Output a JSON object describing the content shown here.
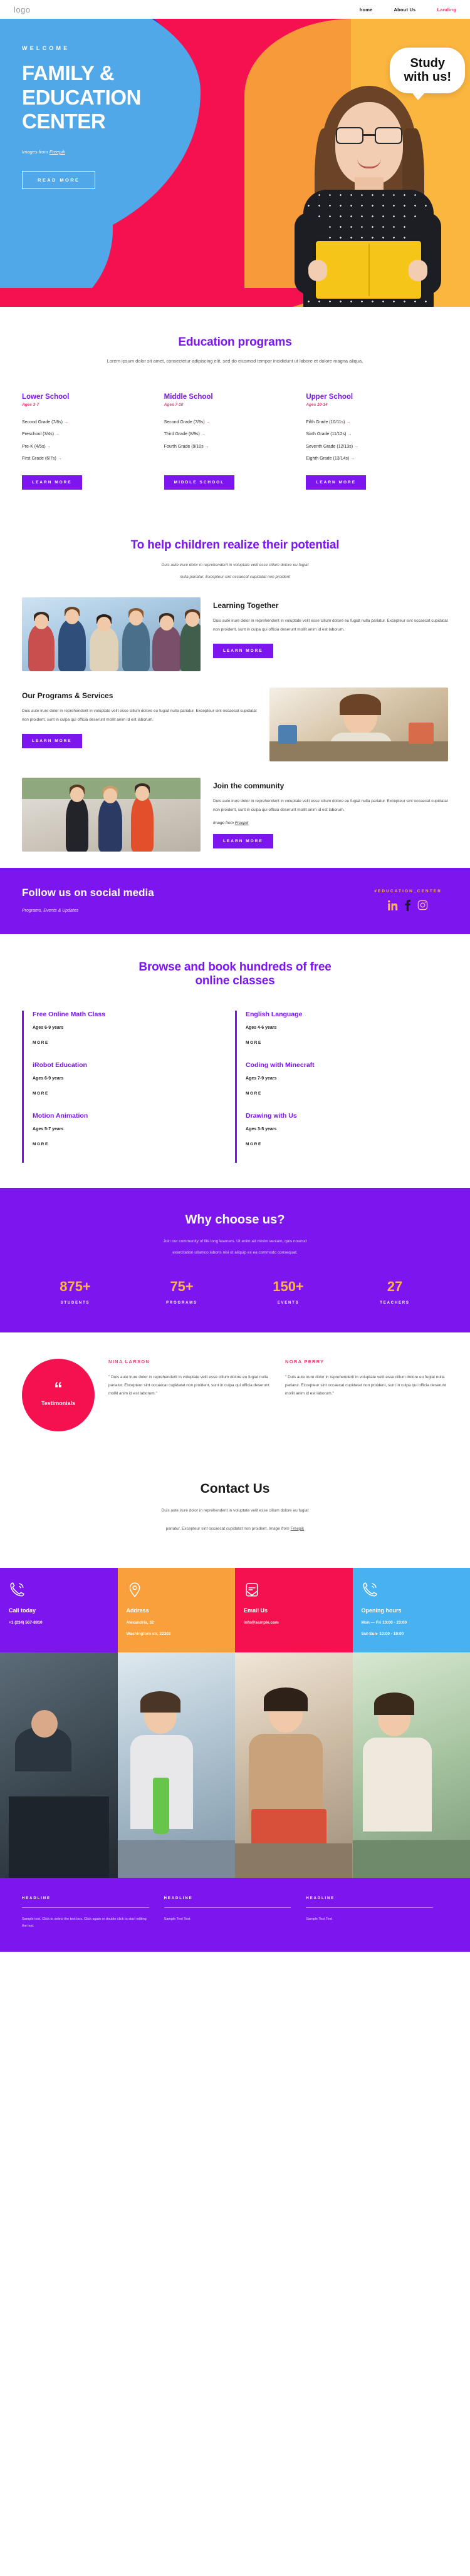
{
  "header": {
    "logo": "logo",
    "nav": [
      {
        "label": "home",
        "active": false
      },
      {
        "label": "About Us",
        "active": false
      },
      {
        "label": "Landing",
        "active": true
      }
    ]
  },
  "hero": {
    "welcome": "WELCOME",
    "title": "FAMILY & EDUCATION CENTER",
    "credit_prefix": "Images from ",
    "credit_link": "Freepik",
    "button": "READ MORE",
    "bubble_line1": "Study",
    "bubble_line2": "with us!"
  },
  "programs": {
    "title": "Education programs",
    "subtitle": "Lorem ipsum dolor sit amet, consectetur adipiscing elit, sed do eiusmod tempor incididunt ut labore et dolore magna aliqua.",
    "columns": [
      {
        "name": "Lower School",
        "age": "Ages 3-7",
        "items": [
          "Second Grade (7/8s)",
          "Preschool (3/4s)",
          "Pre-K (4/5s)",
          "First Grade (6/7s)"
        ],
        "button": "LEARN MORE"
      },
      {
        "name": "Middle School",
        "age": "Ages 7-10",
        "items": [
          "Second Grade (7/8s)",
          "Third Grade (8/9s)",
          "Fourth Grade (9/10s"
        ],
        "button": "MIDDLE SCHOOL"
      },
      {
        "name": "Upper School",
        "age": "Ages 10-14",
        "items": [
          "Fifth Grade (10/11s)",
          "Sixth Grade (11/12s)",
          "Seventh Grade (12/13s)",
          "Eighth Grade (13/14s)"
        ],
        "button": "LEARN MORE"
      }
    ]
  },
  "potential": {
    "title": "To help children realize their potential",
    "sub_line1": "Duis aute irure dolor in reprehenderit in voluptate velit esse cillum dolore eu fugiat",
    "sub_line2": "nulla pariatur. Excepteur sint occaecat cupidatat non proident"
  },
  "features": [
    {
      "title": "Learning Together",
      "body": "Duis aute irure dolor in reprehenderit in voluptate velit esse cillum dolore eu fugiat nulla pariatur. Excepteur sint occaecat cupidatat non proident, sunt in culpa qui officia deserunt mollit anim id est laborum.",
      "button": "LEARN MORE",
      "credit_prefix": "",
      "credit_link": ""
    },
    {
      "title": "Our Programs & Services",
      "body": "Duis aute irure dolor in reprehenderit in voluptate velit esse cillum dolore eu fugiat nulla pariatur. Excepteur sint occaecat cupidatat non proident, sunt in culpa qui officia deserunt mollit anim id est laborum.",
      "button": "LEARN MORE",
      "credit_prefix": "",
      "credit_link": ""
    },
    {
      "title": "Join the community",
      "body": "Duis aute irure dolor in reprehenderit in voluptate velit esse cillum dolore eu fugiat nulla pariatur. Excepteur sint occaecat cupidatat non proident, sunt in culpa qui officia deserunt mollit anim id est laborum.",
      "button": "LEARN MORE",
      "credit_prefix": "Image from ",
      "credit_link": "Freepik"
    }
  ],
  "social": {
    "title": "Follow us on social media",
    "subtitle": "Programs, Events & Updates",
    "hashtag": "#EDUCATION_CENTER",
    "icons": [
      "linkedin-icon",
      "facebook-icon",
      "instagram-icon"
    ]
  },
  "classes": {
    "title_line1": "Browse and book hundreds of free",
    "title_line2": "online classes",
    "items": [
      {
        "name": "Free Online Math Class",
        "age": "Ages 6-9 years",
        "more": "MORE"
      },
      {
        "name": "English Language",
        "age": "Ages 4-6 years",
        "more": "MORE"
      },
      {
        "name": "iRobot Education",
        "age": "Ages 6-9 years",
        "more": "MORE"
      },
      {
        "name": "Coding with Minecraft",
        "age": "Ages 7-9 years",
        "more": "MORE"
      },
      {
        "name": "Motion Animation",
        "age": "Ages 5-7 years",
        "more": "MORE"
      },
      {
        "name": "Drawing with Us",
        "age": "Ages 3-5 years",
        "more": "MORE"
      }
    ]
  },
  "why": {
    "title": "Why choose us?",
    "sub_line1": "Join our community of life long learners. Ut enim ad minim veniam, quis nostrud",
    "sub_line2": "exercitation ullamco laboris nisi ut aliquip ex ea commodo consequat.",
    "stats": [
      {
        "number": "875+",
        "label": "STUDENTS"
      },
      {
        "number": "75+",
        "label": "PROGRAMS"
      },
      {
        "number": "150+",
        "label": "EVENTS"
      },
      {
        "number": "27",
        "label": "TEACHERS"
      }
    ]
  },
  "testimonials": {
    "badge_label": "Testimonials",
    "items": [
      {
        "name": "NINA LARSON",
        "body": "\" Duis aute irure dolor in reprehenderit in voluptate velit esse cillum dolore eu fugiat nulla pariatur. Excepteur sint occaecat cupidatat non proident, sunt in culpa qui officia deserunt mollit anim id est laborum.\""
      },
      {
        "name": "NORA PERRY",
        "body": "\" Duis aute irure dolor in reprehenderit in voluptate velit esse cillum dolore eu fugiat nulla pariatur. Excepteur sint occaecat cupidatat non proident, sunt in culpa qui officia deserunt mollit anim id est laborum.\""
      }
    ]
  },
  "contact": {
    "title": "Contact Us",
    "desc_line1": "Duis aute irure dolor in reprehenderit in voluptate velit esse cillum dolore eu fugiat",
    "desc_line2_prefix": "pariatur. Excepteur sint occaecat cupidatat non proident. ",
    "desc_line2_italic": "Image from ",
    "desc_line2_link": "Freepik",
    "cards": [
      {
        "icon": "phone-icon",
        "title": "Call today",
        "lines": [
          "+1 (234) 567-8910"
        ],
        "color": "#7d15ef"
      },
      {
        "icon": "pin-icon",
        "title": "Address",
        "lines": [
          "Alexandria, 32",
          "Washingtorn str, 22303"
        ],
        "color": "#f9a03c"
      },
      {
        "icon": "mail-icon",
        "title": "Email Us",
        "lines": [
          "info@sample.com"
        ],
        "color": "#f5114f"
      },
      {
        "icon": "clock-icon",
        "title": "Opening hours",
        "lines": [
          "Mon — Fri 10:00 - 23:00",
          "Sut-Sun- 10:00 - 19:00"
        ],
        "color": "#47b2ef"
      }
    ]
  },
  "footer": {
    "columns": [
      {
        "head": "HEADLINE",
        "text": "Sample text. Click to select the text box. Click again or double click to start editing the text."
      },
      {
        "head": "HEADLINE",
        "text": "Sample Text Text"
      },
      {
        "head": "HEADLINE",
        "text": "Sample Text Text"
      }
    ]
  }
}
